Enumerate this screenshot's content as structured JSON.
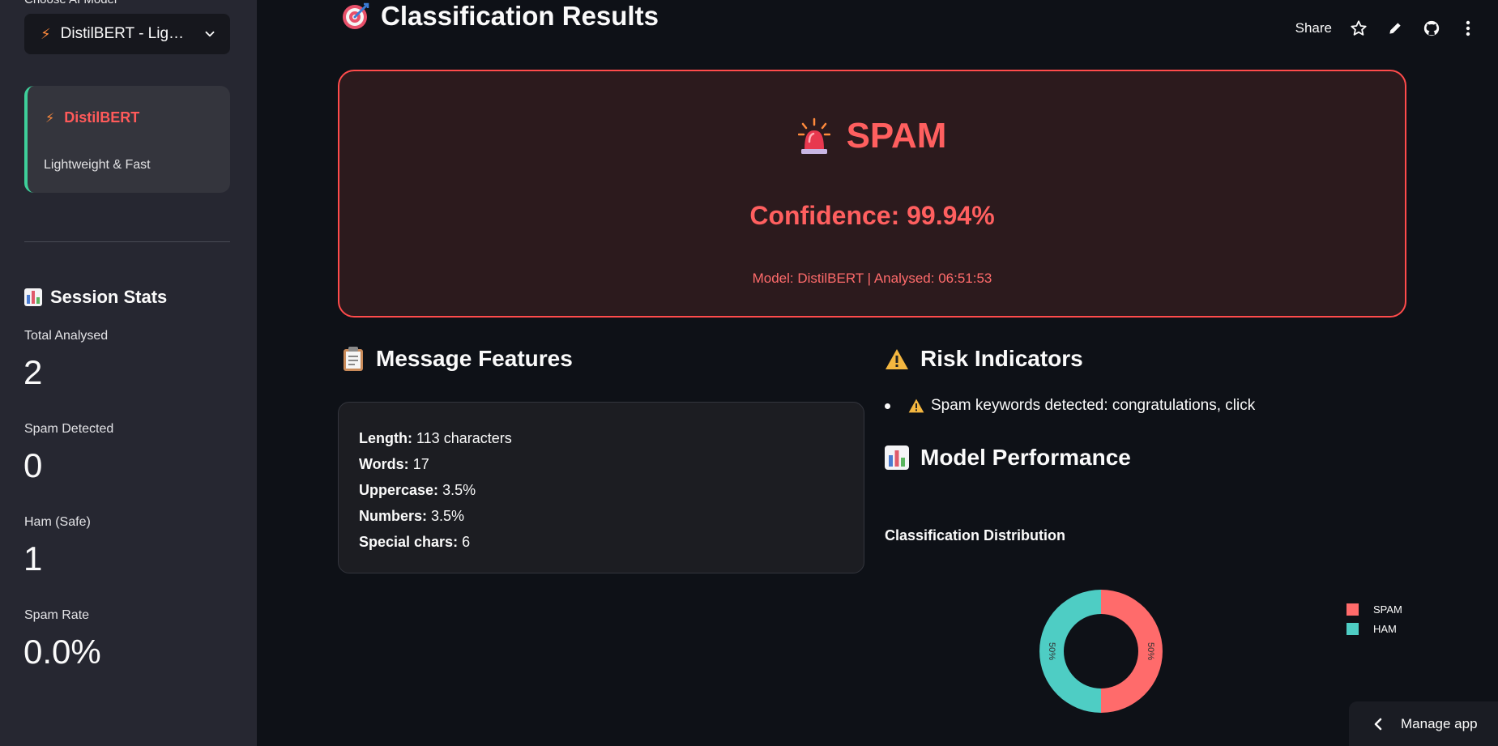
{
  "sidebar": {
    "select_label": "Choose AI Model",
    "selected_model": "DistilBERT - Lig…",
    "model_card": {
      "name": "DistilBERT",
      "description": "Lightweight & Fast"
    },
    "stats_title": "Session Stats",
    "metrics": [
      {
        "label": "Total Analysed",
        "value": "2"
      },
      {
        "label": "Spam Detected",
        "value": "0"
      },
      {
        "label": "Ham (Safe)",
        "value": "1"
      },
      {
        "label": "Spam Rate",
        "value": "0.0%"
      }
    ]
  },
  "header": {
    "title": "Classification Results",
    "share_label": "Share"
  },
  "result": {
    "label": "SPAM",
    "confidence": "Confidence: 99.94%",
    "meta": "Model: DistilBERT | Analysed: 06:51:53"
  },
  "features": {
    "title": "Message Features",
    "items": [
      {
        "key": "Length:",
        "value": "113 characters"
      },
      {
        "key": "Words:",
        "value": "17"
      },
      {
        "key": "Uppercase:",
        "value": "3.5%"
      },
      {
        "key": "Numbers:",
        "value": "3.5%"
      },
      {
        "key": "Special chars:",
        "value": "6"
      }
    ]
  },
  "risk": {
    "title": "Risk Indicators",
    "items": [
      "Spam keywords detected: congratulations, click"
    ]
  },
  "performance": {
    "title": "Model Performance"
  },
  "chart_data": {
    "type": "pie",
    "title": "Classification Distribution",
    "categories": [
      "SPAM",
      "HAM"
    ],
    "values": [
      50,
      50
    ],
    "labels": [
      "50%",
      "50%"
    ],
    "colors": [
      "#ff6b6b",
      "#4ecdc4"
    ],
    "donut": true,
    "legend": "top-right"
  },
  "footer": {
    "manage_app": "Manage app"
  },
  "colors": {
    "accent_red": "#ff4b4b",
    "teal": "#4ecdc4",
    "background": "#0e1117",
    "sidebar": "#262731"
  }
}
